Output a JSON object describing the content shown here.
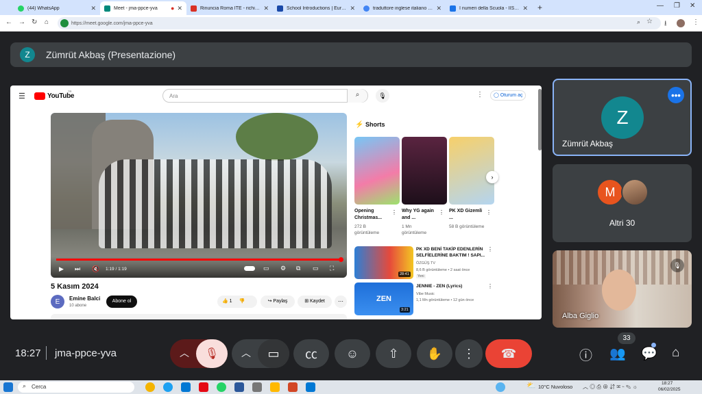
{
  "tabs": [
    {
      "title": "(44) WhatsApp",
      "color": "#25d366"
    },
    {
      "title": "Meet - jma-ppce-yva",
      "color": "#00897b"
    },
    {
      "title": "Rinuncia Roma ITE - richiesta",
      "color": "#d93025"
    },
    {
      "title": "School Introductions | Europe",
      "color": "#1a49a8"
    },
    {
      "title": "traduttore inglese italiano - Co",
      "color": "#4285f4"
    },
    {
      "title": "I numeri della Scuola - IIS E.S.C",
      "color": "#1a73e8"
    }
  ],
  "new_tab": "+",
  "url": "https://meet.google.com/jma-ppce-yva",
  "presenter": {
    "initial": "Z",
    "label": "Zümrüt Akbaş (Presentazione)"
  },
  "youtube": {
    "logo": "YouTube",
    "logo_sup": "TR",
    "search_placeholder": "Ara",
    "signin": "Oturum aç",
    "video": {
      "time": "1:19 / 1:19",
      "title": "5 Kasım 2024",
      "channel": "Emine Balci",
      "subs": "10 abone",
      "avatar": "E",
      "subscribe": "Abone ol",
      "likes": "1",
      "share": "Paylaş",
      "save": "Kaydet"
    },
    "shorts_heading": "Shorts",
    "shorts": [
      {
        "title": "Opening Christmas...",
        "views": "272 B görüntüleme",
        "thumb": "#5fb8f0"
      },
      {
        "title": "Why YG again and ...",
        "views": "1 Mn görüntüleme",
        "thumb": "#3a1b2e"
      },
      {
        "title": "PK XD Gizemli ...",
        "views": "58 B görüntüleme",
        "thumb": "#d8a44a"
      }
    ],
    "list": [
      {
        "title": "PK XD BENİ TAKİP EDENLERİN SELFİELERİNE BAKTIM ! SAPI...",
        "channel": "ÖZGÜŞ TV",
        "meta": "8,6 B görüntüleme • 2 saat önce",
        "badge": "Yeni",
        "duration": "28:41",
        "thumb": "#2d7fd6"
      },
      {
        "title": "JENNIE - ZEN (Lyrics)",
        "channel": "Vibe Music",
        "meta": "1,1 Mn görüntüleme • 12 gün önce",
        "duration": "3:21",
        "thumb": "#1e6fd9",
        "thumb_text": "ZEN"
      }
    ]
  },
  "participants": [
    {
      "name": "Zümrüt Akbaş",
      "initial": "Z"
    },
    {
      "name": "Altri 30",
      "initials": [
        "M",
        ""
      ]
    },
    {
      "name": "Alba Giglio"
    }
  ],
  "footer": {
    "time": "18:27",
    "meeting": "jma-ppce-yva",
    "count": "33"
  },
  "taskbar": {
    "search": "Cerca",
    "weather": "10°C  Nuvoloso",
    "clock": "18:27",
    "date": "06/02/2025"
  },
  "colors": {
    "accent": "#8ab4f8",
    "end_call": "#ea4335",
    "mute": "#f9dedc",
    "teal": "#12878f"
  }
}
